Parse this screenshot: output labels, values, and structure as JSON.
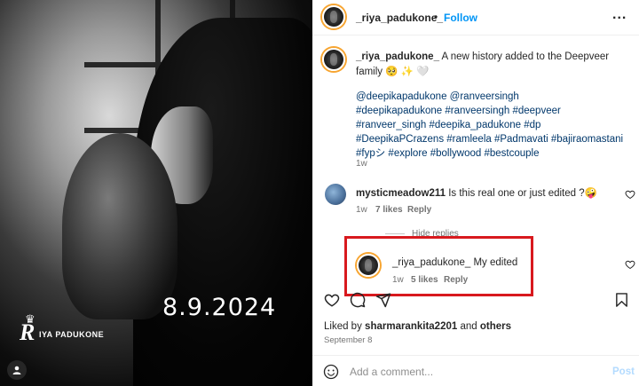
{
  "photo": {
    "date_overlay": "8.9.2024",
    "logo_big": "R",
    "logo_rest": "IYA PADUKONE"
  },
  "header": {
    "username": "_riya_padukone_",
    "separator": "•",
    "follow_label": "Follow",
    "more_label": "..."
  },
  "caption": {
    "username": "_riya_padukone_",
    "text": "A new history added to the Deepveer family 🥺 ✨ 🤍",
    "hashtags_line1": "@deepikapadukone @ranveersingh",
    "hashtags_line2": "#deepikapadukone #ranveersingh #deepveer",
    "hashtags_line3": "#ranveer_singh #deepika_padukone #dp",
    "hashtags_line4": "#DeepikaPCrazens #ramleela #Padmavati #bajiraomastani",
    "hashtags_line5": "#fypシ #explore #bollywood #bestcouple",
    "time": "1w"
  },
  "comments": [
    {
      "username": "mysticmeadow211",
      "text": "Is this real one or just edited ?🤪",
      "time": "1w",
      "likes": "7 likes",
      "reply": "Reply"
    }
  ],
  "hide_replies": "Hide replies",
  "reply": {
    "username": "_riya_padukone_",
    "text": "My edited",
    "time": "1w",
    "likes": "5 likes",
    "reply": "Reply"
  },
  "likes": {
    "prefix": "Liked by",
    "user": "sharmarankita2201",
    "and": "and",
    "others": "others"
  },
  "post_date": "September 8",
  "comment_box": {
    "placeholder": "Add a comment...",
    "post_label": "Post"
  },
  "colors": {
    "link": "#00376b",
    "follow": "#0095f6",
    "highlight": "#d8191e"
  }
}
